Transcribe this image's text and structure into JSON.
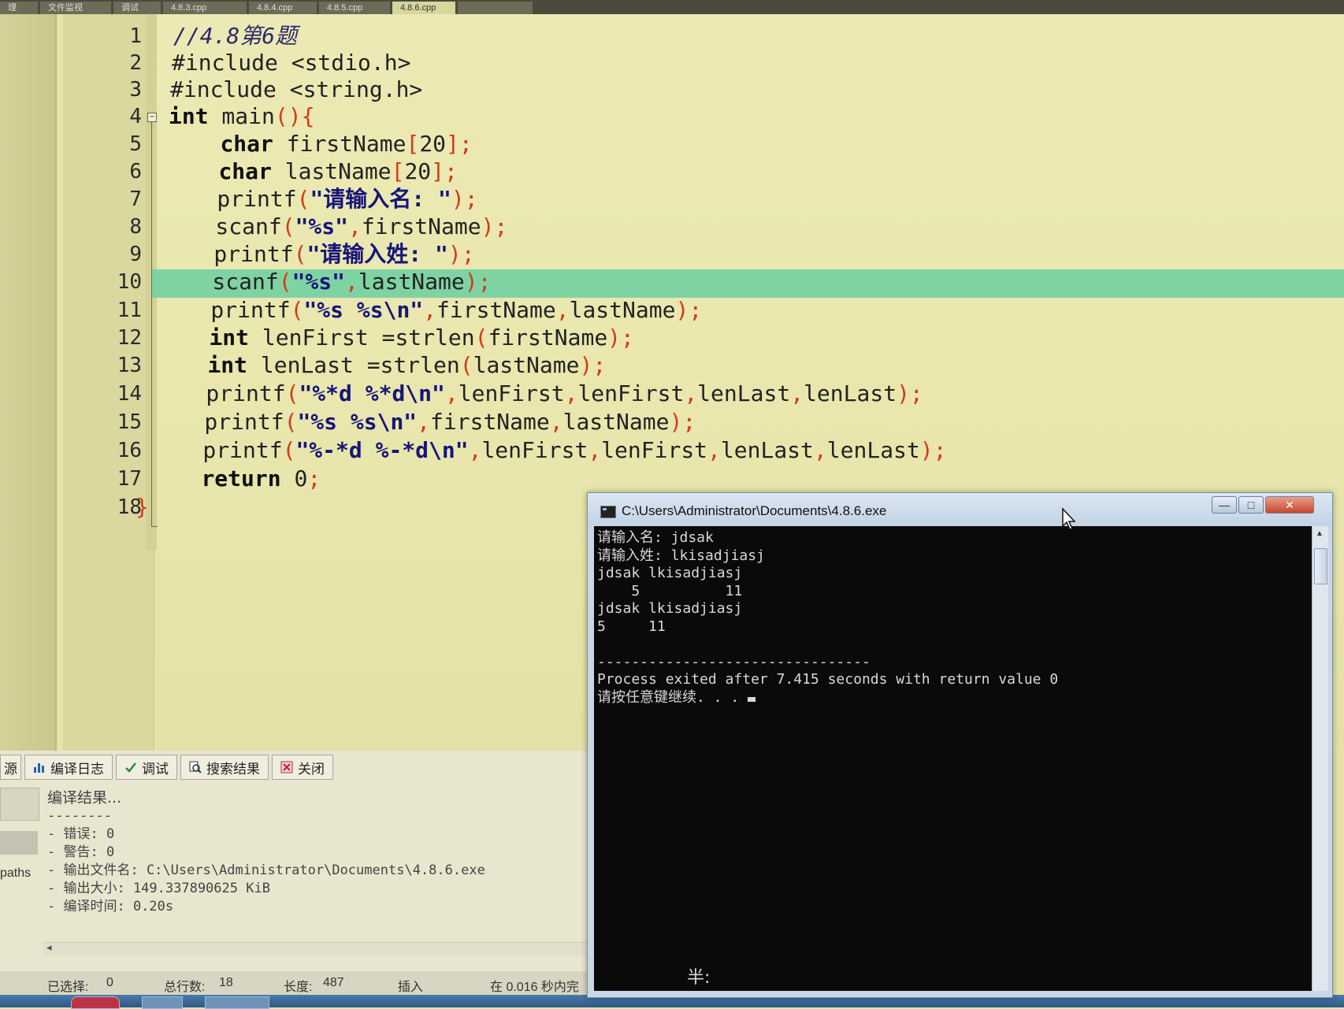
{
  "tabs": [
    "理",
    "文件监视",
    "调试",
    "4.8.3.cpp",
    "4.8.4.cpp",
    "4.8.5.cpp",
    "4.8.6.cpp",
    ""
  ],
  "active_tab_index": 6,
  "editor": {
    "line_numbers": [
      "1",
      "2",
      "3",
      "4",
      "5",
      "6",
      "7",
      "8",
      "9",
      "10",
      "11",
      "12",
      "13",
      "14",
      "15",
      "16",
      "17",
      "18"
    ],
    "highlighted_line": 10,
    "lines": [
      "//4.8第6题",
      "#include <stdio.h>",
      "#include <string.h>",
      "int main(){",
      "    char firstName[20];",
      "    char lastName[20];",
      "    printf(\"请输入名: \");",
      "    scanf(\"%s\",firstName);",
      "    printf(\"请输入姓: \");",
      "    scanf(\"%s\",lastName);",
      "    printf(\"%s %s\\n\",firstName,lastName);",
      "    int lenFirst =strlen(firstName);",
      "    int lenLast =strlen(lastName);",
      "    printf(\"%*d %*d\\n\",lenFirst,lenFirst,lenLast,lenLast);",
      "    printf(\"%s %s\\n\",firstName,lastName);",
      "    printf(\"%-*d %-*d\\n\",lenFirst,lenFirst,lenLast,lenLast);",
      "    return 0;",
      "}"
    ]
  },
  "bottom_panel": {
    "left_cut_tab": "源",
    "tabs": [
      "编译日志",
      "调试",
      "搜索结果",
      "关闭"
    ],
    "log": [
      "编译结果...",
      "--------",
      "- 错误: 0",
      "- 警告: 0",
      "- 输出文件名: C:\\Users\\Administrator\\Documents\\4.8.6.exe",
      "- 输出大小: 149.337890625 KiB",
      "- 编译时间: 0.20s"
    ],
    "left_label": "paths"
  },
  "statusbar": {
    "selected_label": "已选择:",
    "selected_value": "0",
    "total_lines_label": "总行数:",
    "total_lines_value": "18",
    "length_label": "长度:",
    "length_value": "487",
    "mode": "插入",
    "time_text": "在 0.016 秒内完"
  },
  "console": {
    "title": "C:\\Users\\Administrator\\Documents\\4.8.6.exe",
    "lines": [
      "请输入名: jdsak",
      "请输入姓: lkisadjiasj",
      "jdsak lkisadjiasj",
      "    5          11",
      "jdsak lkisadjiasj",
      "5     11",
      "",
      "--------------------------------",
      "Process exited after 7.415 seconds with return value 0",
      "请按任意键继续. . . "
    ],
    "ime_indicator": "半:",
    "minimize": "—",
    "maximize": "□",
    "close": "✕"
  }
}
